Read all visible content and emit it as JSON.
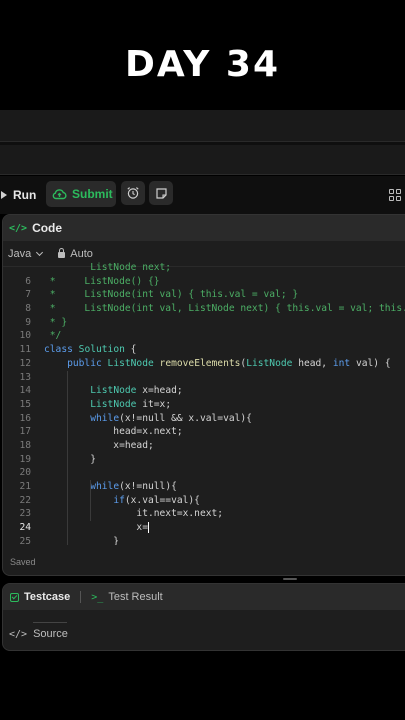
{
  "banner": {
    "title": "DAY 34"
  },
  "toolbar": {
    "run_label": "Run",
    "submit_label": "Submit",
    "alarm_icon": "alarm-clock-icon",
    "note_icon": "note-icon",
    "layout_icon": "layout-grid-icon",
    "submit_color": "#2cbb5d"
  },
  "editor": {
    "header_label": "Code",
    "code_glyph": "</>",
    "language": "Java",
    "mode": "Auto",
    "status": "Saved",
    "lines": [
      {
        "n": "",
        "t": "        ListNode next;"
      },
      {
        "n": "6",
        "t": " *     ListNode() {}"
      },
      {
        "n": "7",
        "t": " *     ListNode(int val) { this.val = val; }"
      },
      {
        "n": "8",
        "t": " *     ListNode(int val, ListNode next) { this.val = val; this.next = next; }"
      },
      {
        "n": "9",
        "t": " * }"
      },
      {
        "n": "10",
        "t": " */"
      },
      {
        "n": "11",
        "t": "class Solution {"
      },
      {
        "n": "12",
        "t": "    public ListNode removeElements(ListNode head, int val) {"
      },
      {
        "n": "13",
        "t": ""
      },
      {
        "n": "14",
        "t": "        ListNode x=head;"
      },
      {
        "n": "15",
        "t": "        ListNode it=x;"
      },
      {
        "n": "16",
        "t": "        while(x!=null && x.val=val){"
      },
      {
        "n": "17",
        "t": "            head=x.next;"
      },
      {
        "n": "18",
        "t": "            x=head;"
      },
      {
        "n": "19",
        "t": "        }"
      },
      {
        "n": "20",
        "t": ""
      },
      {
        "n": "21",
        "t": "        while(x!=null){"
      },
      {
        "n": "22",
        "t": "            if(x.val==val){"
      },
      {
        "n": "23",
        "t": "                it.next=x.next;"
      },
      {
        "n": "24",
        "t": "                x="
      },
      {
        "n": "25",
        "t": "            }"
      }
    ],
    "active_line": "24"
  },
  "bottom": {
    "tab_testcase": "Testcase",
    "tab_result": "Test Result",
    "result_glyph": ">_",
    "source_label": "Source",
    "source_glyph": "</>"
  }
}
